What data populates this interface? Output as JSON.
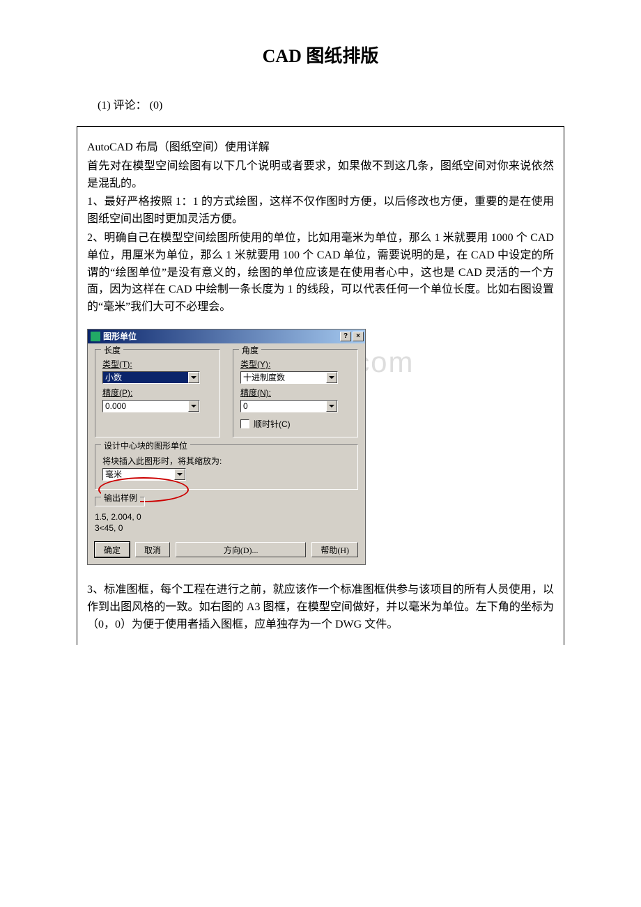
{
  "title": "CAD 图纸排版",
  "meta": {
    "rating": "(1)",
    "comments_label": "评论：",
    "comments_count": "(0)"
  },
  "watermark": "www.bdocx.com",
  "content": {
    "p0": "AutoCAD 布局（图纸空间）使用详解",
    "p1": "首先对在模型空间绘图有以下几个说明或者要求，如果做不到这几条，图纸空间对你来说依然是混乱的。",
    "p2": "1、最好严格按照 1：1 的方式绘图，这样不仅作图时方便，以后修改也方便，重要的是在使用图纸空间出图时更加灵活方便。",
    "p3": "2、明确自己在模型空间绘图所使用的单位，比如用毫米为单位，那么 1 米就要用 1000 个 CAD 单位，用厘米为单位，那么 1 米就要用 100 个 CAD 单位，需要说明的是，在 CAD 中设定的所谓的“绘图单位”是没有意义的，绘图的单位应该是在使用者心中，这也是 CAD 灵活的一个方面，因为这样在 CAD 中绘制一条长度为 1 的线段，可以代表任何一个单位长度。比如右图设置的“毫米”我们大可不必理会。",
    "p4": "3、标准图框，每个工程在进行之前，就应该作一个标准图框供参与该项目的所有人员使用，以作到出图风格的一致。如右图的 A3 图框，在模型空间做好，并以毫米为单位。左下角的坐标为（0，0）为便于使用者插入图框，应单独存为一个 DWG 文件。"
  },
  "dialog": {
    "title": "图形单位",
    "length": {
      "group": "长度",
      "type_label": "类型(T):",
      "type_value": "小数",
      "precision_label": "精度(P):",
      "precision_value": "0.000"
    },
    "angle": {
      "group": "角度",
      "type_label": "类型(Y):",
      "type_value": "十进制度数",
      "precision_label": "精度(N):",
      "precision_value": "0",
      "clockwise": "顺时针(C)"
    },
    "design_block": {
      "group": "设计中心块的图形单位",
      "hint": "将块插入此图形时，将其缩放为:",
      "value": "毫米"
    },
    "sample": {
      "group": "输出样例",
      "line1": "1.5, 2.004, 0",
      "line2": "3<45, 0"
    },
    "buttons": {
      "ok": "确定",
      "cancel": "取消",
      "direction": "方向(D)...",
      "help": "帮助(H)"
    },
    "sys": {
      "help": "?",
      "close": "×"
    }
  }
}
